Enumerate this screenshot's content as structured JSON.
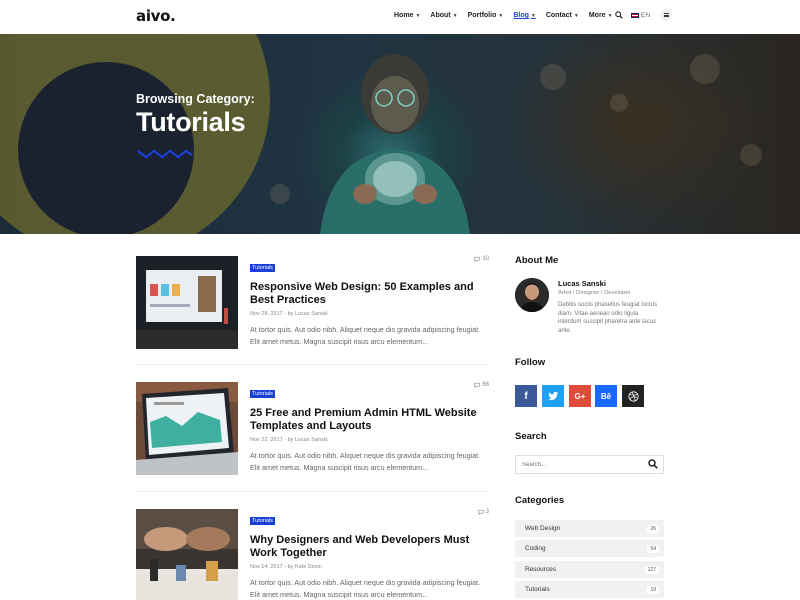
{
  "header": {
    "logo": "aivo.",
    "nav": [
      {
        "label": "Home"
      },
      {
        "label": "About"
      },
      {
        "label": "Portfolio"
      },
      {
        "label": "Blog",
        "active": true
      },
      {
        "label": "Contact"
      },
      {
        "label": "More"
      }
    ],
    "lang": "EN"
  },
  "hero": {
    "subtitle": "Browsing Category:",
    "title": "Tutorials"
  },
  "posts": [
    {
      "badge": "Tutorials",
      "comments": "10",
      "title": "Responsive Web Design: 50 Examples and Best Practices",
      "meta": "Nov 28, 2017 - by Lucas Sanski",
      "excerpt": "At tortor quis. Aut odio nibh. Aliquet neque dis gravida adipiscing feugiat. Elit amet metus. Magna suscipit risus arcu elementum..."
    },
    {
      "badge": "Tutorials",
      "comments": "66",
      "title": "25 Free and Premium Admin HTML Website Templates and Layouts",
      "meta": "Nov 22, 2017 - by Lucas Sanski",
      "excerpt": "At tortor quis. Aut odio nibh. Aliquet neque dis gravida adipiscing feugiat. Elit amet metus. Magna suscipit risus arcu elementum..."
    },
    {
      "badge": "Tutorials",
      "comments": "3",
      "title": "Why Designers and Web Developers Must Work Together",
      "meta": "Nov 14, 2017 - by Kate Dixon",
      "excerpt": "At tortor quis. Aut odio nibh. Aliquet neque dis gravida adipiscing feugiat. Elit amet metus. Magna suscipit risus arcu elementum..."
    }
  ],
  "sidebar": {
    "about_title": "About Me",
    "author_name": "Lucas Sanski",
    "author_role": "Artist / Designer / Developer",
    "author_bio": "Debitis sociis phasellus feugiat luctus diam. Vitae aenean odio ligula interdum suscipit pharetra ante lacus ante.",
    "follow_title": "Follow",
    "social": [
      {
        "icon": "facebook-icon",
        "glyph": "f",
        "color": "#3b5998"
      },
      {
        "icon": "twitter-icon",
        "glyph": "t",
        "color": "#1da1f2"
      },
      {
        "icon": "google-plus-icon",
        "glyph": "G+",
        "color": "#dd4b39"
      },
      {
        "icon": "behance-icon",
        "glyph": "Bē",
        "color": "#1769ff"
      },
      {
        "icon": "dribbble-icon",
        "glyph": "◎",
        "color": "#222222"
      }
    ],
    "search_title": "Search",
    "search_placeholder": "Search...",
    "categories_title": "Categories",
    "categories": [
      {
        "name": "Web Design",
        "count": "26"
      },
      {
        "name": "Coding",
        "count": "54"
      },
      {
        "name": "Resources",
        "count": "127"
      },
      {
        "name": "Tutorials",
        "count": "19"
      }
    ]
  },
  "colors": {
    "accent": "#1a3fd6",
    "hero_yellow": "#6e6a2c",
    "hero_dark": "#1a2230"
  }
}
